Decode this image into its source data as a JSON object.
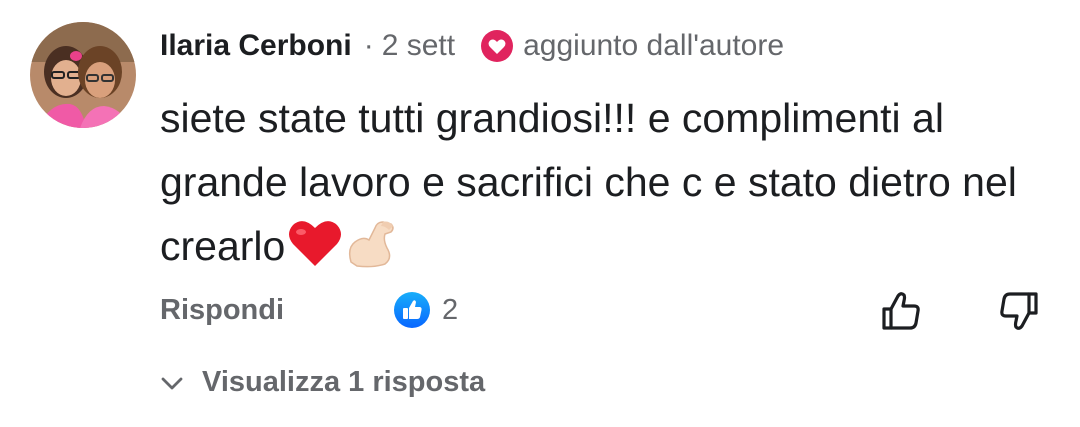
{
  "comment": {
    "author": "Ilaria Cerboni",
    "separator": "·",
    "time": "2 sett",
    "badge_label": "aggiunto dall'autore",
    "badge_icon": "heart-badge-icon",
    "text": "siete state tutti grandiosi!!! e complimenti al grande lavoro e sacrifici che c e stato dietro nel crearlo",
    "trailing_emojis": [
      "red-heart-emoji",
      "flexed-biceps-emoji"
    ]
  },
  "actions": {
    "reply_label": "Rispondi",
    "reaction_icon": "like-icon",
    "reaction_count": "2",
    "like_button_icon": "thumb-up-icon",
    "dislike_button_icon": "thumb-down-icon"
  },
  "replies": {
    "label": "Visualizza 1 risposta",
    "icon": "chevron-down-icon"
  },
  "colors": {
    "primary_text": "#1c1e21",
    "secondary_text": "#65676b",
    "like_blue": "#1877f2",
    "badge_pink": "#e0245e"
  }
}
